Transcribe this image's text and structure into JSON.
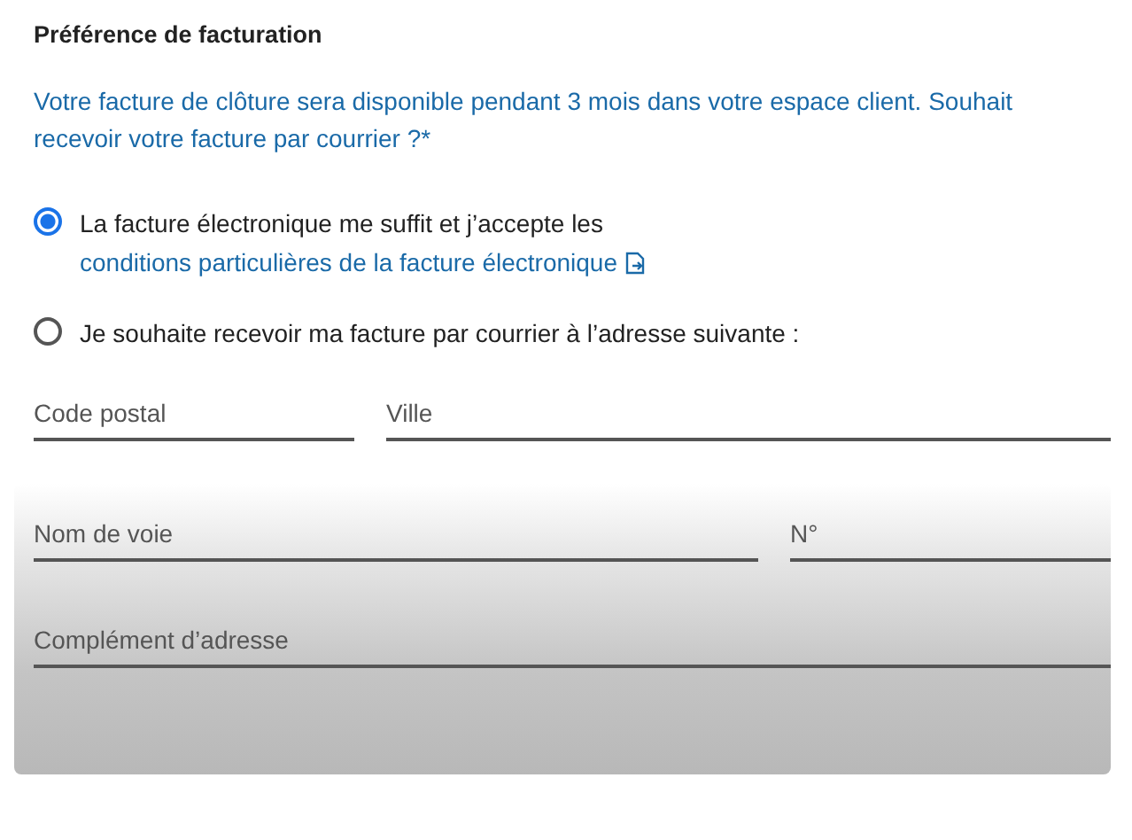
{
  "title": "Préférence de facturation",
  "intro": "Votre facture de clôture sera disponible pendant 3 mois dans votre espace client. Souhait recevoir votre facture par courrier ?*",
  "options": [
    {
      "selected": true,
      "text": "La facture électronique me suffit et j’accepte les ",
      "link": "conditions particulières de la facture électronique"
    },
    {
      "selected": false,
      "text": "Je souhaite recevoir ma facture par courrier à l’adresse suivante :"
    }
  ],
  "address_rows": [
    [
      {
        "placeholder": "Code postal",
        "kind": "narrow"
      },
      {
        "placeholder": "Ville",
        "kind": "wide"
      }
    ],
    [
      {
        "placeholder": "Nom de voie",
        "kind": "wide"
      },
      {
        "placeholder": "N°",
        "kind": "narrow"
      }
    ],
    [
      {
        "placeholder": "Complément d’adresse",
        "kind": "wide"
      }
    ]
  ]
}
